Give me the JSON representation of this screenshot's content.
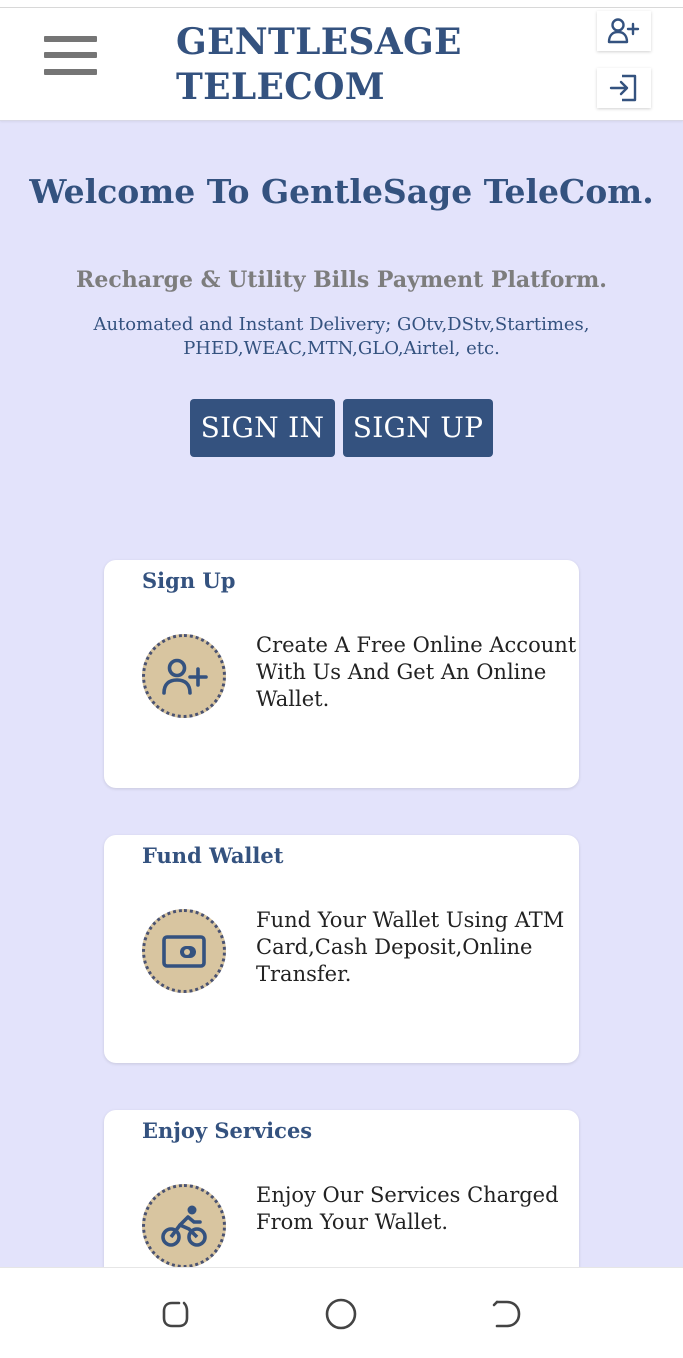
{
  "header": {
    "brand_line1": "GENTLESAGE",
    "brand_line2": "TELECOM",
    "menu_icon": "hamburger-menu-icon",
    "signup_icon": "user-plus-icon",
    "login_icon": "sign-in-icon"
  },
  "hero": {
    "welcome": "Welcome To GentleSage TeleCom.",
    "tagline": "Recharge & Utility Bills Payment Platform.",
    "description": "Automated and Instant Delivery; GOtv,DStv,Startimes, PHED,WEAC,MTN,GLO,Airtel, etc.",
    "sign_in_label": "SIGN IN",
    "sign_up_label": "SIGN UP"
  },
  "cards": [
    {
      "title": "Sign Up",
      "text": "Create A Free Online Account With Us And Get An Online Wallet.",
      "icon": "user-plus-icon"
    },
    {
      "title": "Fund Wallet",
      "text": "Fund Your Wallet Using ATM Card,Cash Deposit,Online Transfer.",
      "icon": "wallet-icon"
    },
    {
      "title": "Enjoy Services",
      "text": "Enjoy Our Services Charged From Your Wallet.",
      "icon": "bicycle-rider-icon"
    }
  ],
  "colors": {
    "primary": "#34527f",
    "background": "#e3e3fb",
    "icon_circle": "#d8c5a0",
    "tagline_gray": "#7d7d7d"
  },
  "nav": {
    "recent_icon": "recent-apps-icon",
    "home_icon": "home-circle-icon",
    "back_icon": "back-icon"
  }
}
